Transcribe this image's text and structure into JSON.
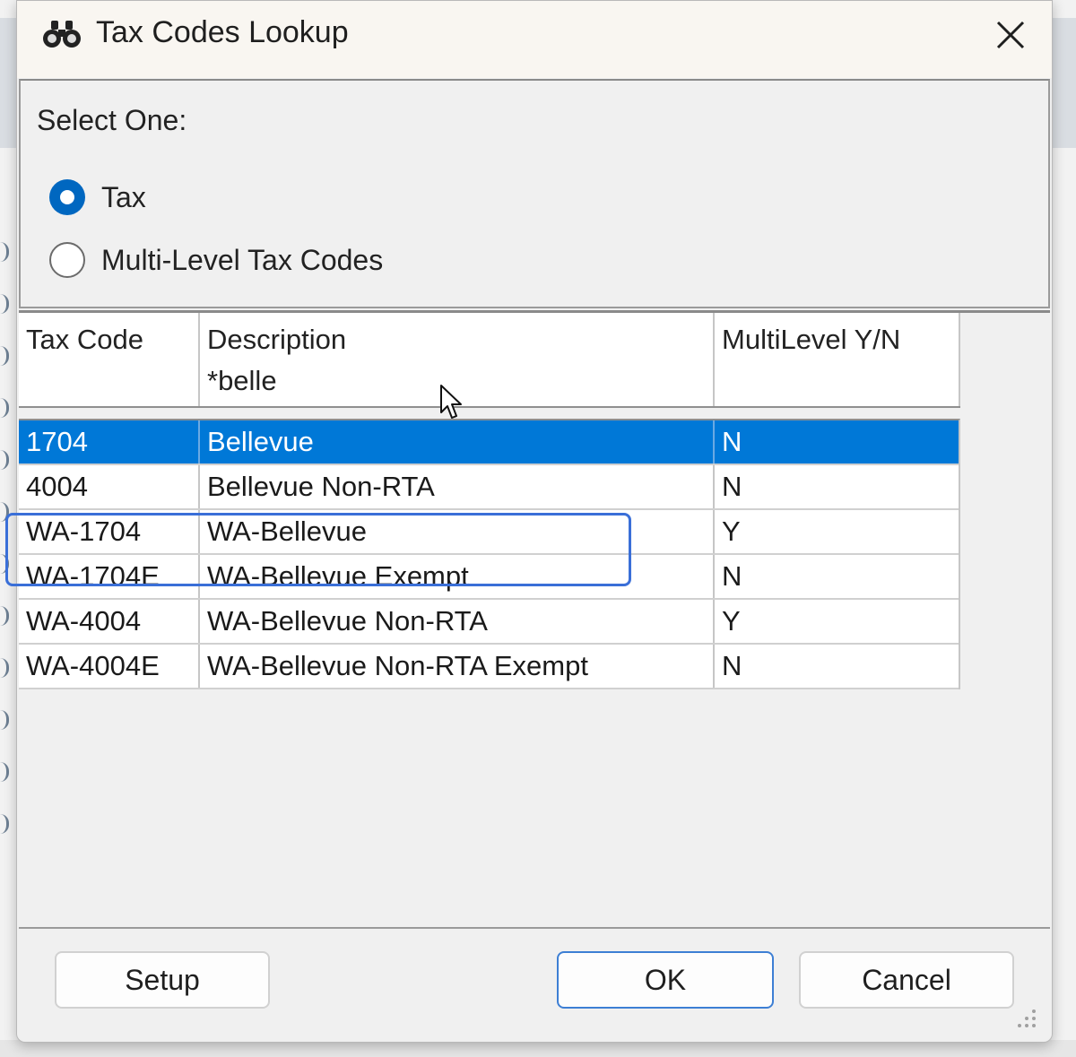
{
  "dialog": {
    "title": "Tax Codes Lookup",
    "title_icon": "binoculars-icon",
    "close_icon": "close-icon"
  },
  "select": {
    "label": "Select One:",
    "options": [
      {
        "label": "Tax",
        "checked": true
      },
      {
        "label": "Multi-Level Tax Codes",
        "checked": false
      }
    ]
  },
  "grid": {
    "columns": [
      "Tax Code",
      "Description",
      "MultiLevel Y/N"
    ],
    "description_filter": "*belle",
    "rows": [
      {
        "code": "1704",
        "description": "Bellevue",
        "multilevel": "N",
        "selected": true
      },
      {
        "code": "4004",
        "description": "Bellevue Non-RTA",
        "multilevel": "N",
        "selected": false
      },
      {
        "code": "WA-1704",
        "description": "WA-Bellevue",
        "multilevel": "Y",
        "selected": false
      },
      {
        "code": "WA-1704E",
        "description": "WA-Bellevue Exempt",
        "multilevel": "N",
        "selected": false
      },
      {
        "code": "WA-4004",
        "description": "WA-Bellevue Non-RTA",
        "multilevel": "Y",
        "selected": false
      },
      {
        "code": "WA-4004E",
        "description": "WA-Bellevue Non-RTA Exempt",
        "multilevel": "N",
        "selected": false
      }
    ]
  },
  "buttons": {
    "setup": "Setup",
    "ok": "OK",
    "cancel": "Cancel"
  },
  "colors": {
    "selection": "#0078d7",
    "radio_checked": "#0067c0",
    "highlight_box": "#3a6fd8"
  }
}
